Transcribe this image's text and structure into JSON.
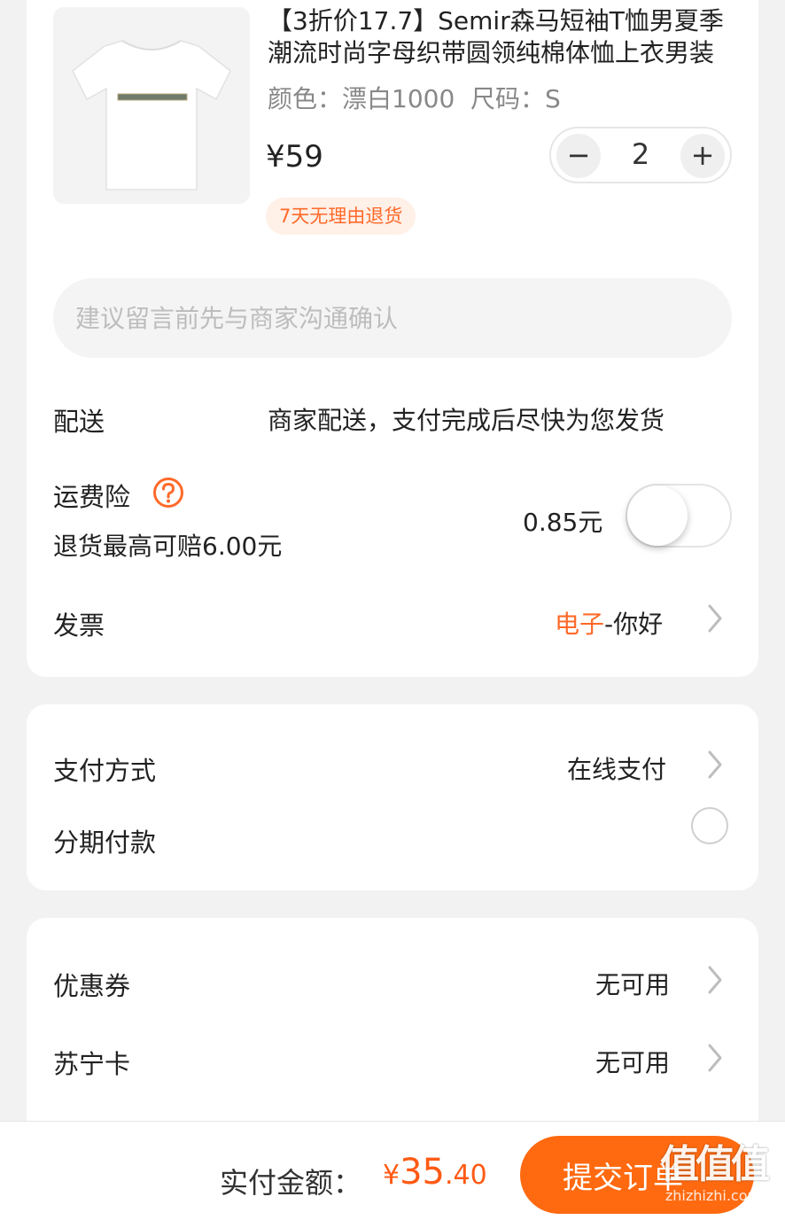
{
  "product": {
    "title": "【3折价17.7】Semir森马短袖T恤男夏季潮流时尚字母织带圆领纯棉体恤上衣男装",
    "spec": "颜色：漂白1000  尺码：S",
    "price": "¥59",
    "quantity": "2",
    "minus": "−",
    "plus": "+",
    "return_tag": "7天无理由退货",
    "image_alt": "white-tshirt"
  },
  "remark": {
    "placeholder": "建议留言前先与商家沟通确认"
  },
  "delivery": {
    "label": "配送",
    "value": "商家配送，支付完成后尽快为您发货"
  },
  "shipping_insurance": {
    "label": "运费险",
    "sub": "退货最高可赔6.00元",
    "price": "0.85元",
    "enabled": false
  },
  "invoice": {
    "label": "发票",
    "type": "电子",
    "title": "-你好"
  },
  "payment": {
    "method_label": "支付方式",
    "method_value": "在线支付",
    "installment_label": "分期付款"
  },
  "discounts": {
    "coupon_label": "优惠券",
    "coupon_value": "无可用",
    "card_label": "苏宁卡",
    "card_value": "无可用"
  },
  "bottom": {
    "total_label": "实付金额：",
    "currency": "¥",
    "amount_int": "35",
    "amount_dec": ".40",
    "submit": "提交订单"
  },
  "watermark": {
    "logo": "值值值",
    "url": "zhizhizhi.com"
  },
  "colors": {
    "accent": "#ff6a10",
    "price_orange": "#ff5a14",
    "tag_bg": "#fff0e8"
  }
}
